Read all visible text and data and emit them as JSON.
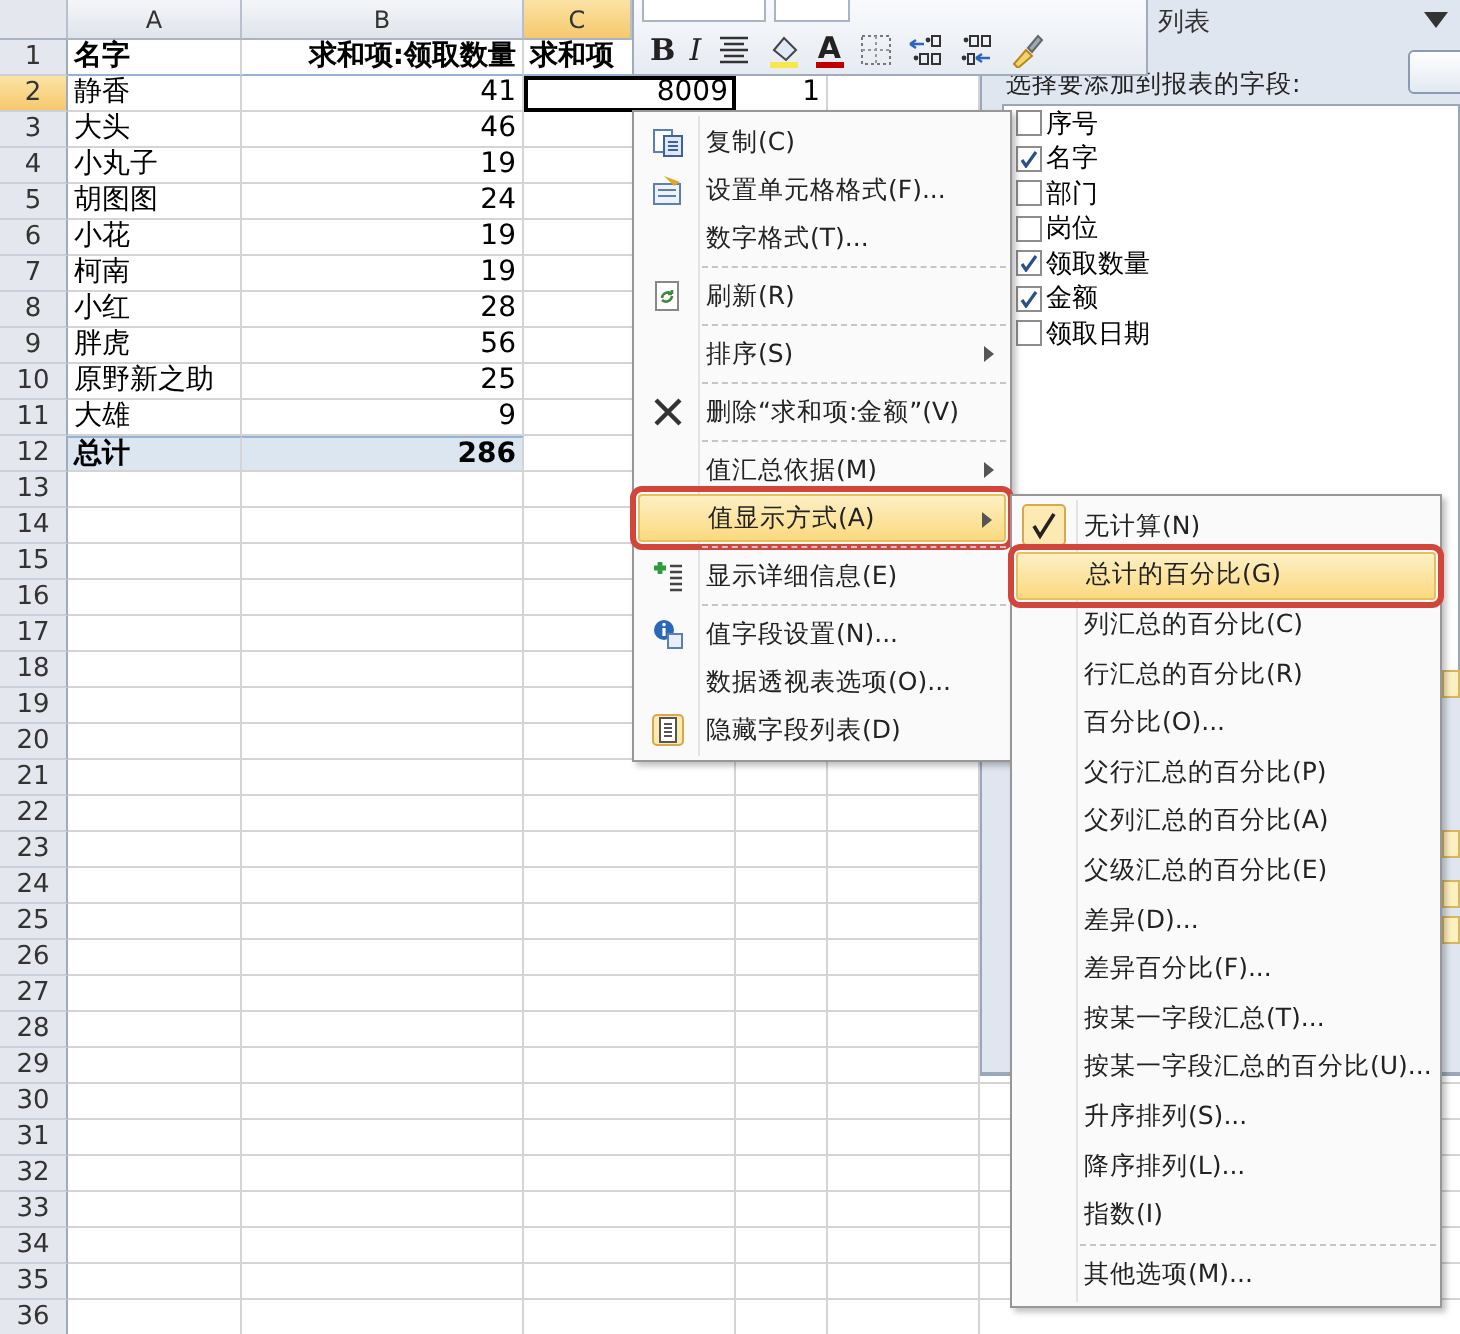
{
  "sheet": {
    "columns": [
      {
        "label": "A",
        "selected": false
      },
      {
        "label": "B",
        "selected": false
      },
      {
        "label": "C",
        "selected": true
      }
    ],
    "row_numbers": [
      {
        "label": "1",
        "selected": false
      },
      {
        "label": "2",
        "selected": true
      },
      {
        "label": "3",
        "selected": false
      },
      {
        "label": "4",
        "selected": false
      },
      {
        "label": "5",
        "selected": false
      },
      {
        "label": "6",
        "selected": false
      },
      {
        "label": "7",
        "selected": false
      },
      {
        "label": "8",
        "selected": false
      },
      {
        "label": "9",
        "selected": false
      },
      {
        "label": "10",
        "selected": false
      },
      {
        "label": "11",
        "selected": false
      },
      {
        "label": "12",
        "selected": false
      },
      {
        "label": "13",
        "selected": false
      },
      {
        "label": "14",
        "selected": false
      },
      {
        "label": "15",
        "selected": false
      },
      {
        "label": "16",
        "selected": false
      },
      {
        "label": "17",
        "selected": false
      },
      {
        "label": "18",
        "selected": false
      },
      {
        "label": "19",
        "selected": false
      },
      {
        "label": "20",
        "selected": false
      },
      {
        "label": "21",
        "selected": false
      },
      {
        "label": "22",
        "selected": false
      },
      {
        "label": "23",
        "selected": false
      },
      {
        "label": "24",
        "selected": false
      },
      {
        "label": "25",
        "selected": false
      },
      {
        "label": "26",
        "selected": false
      },
      {
        "label": "27",
        "selected": false
      },
      {
        "label": "28",
        "selected": false
      },
      {
        "label": "29",
        "selected": false
      },
      {
        "label": "30",
        "selected": false
      },
      {
        "label": "31",
        "selected": false
      },
      {
        "label": "32",
        "selected": false
      },
      {
        "label": "33",
        "selected": false
      },
      {
        "label": "34",
        "selected": false
      },
      {
        "label": "35",
        "selected": false
      },
      {
        "label": "36",
        "selected": false
      }
    ],
    "header_row": {
      "column_1": "名字",
      "column_2": "求和项:领取数量",
      "column_3": "求和项"
    },
    "rows": [
      {
        "name": "静香",
        "quantity": "41",
        "column_3": {
          "value": "8009",
          "selected": true
        },
        "column_4": "1"
      },
      {
        "name": "大头",
        "quantity": "46"
      },
      {
        "name": "小丸子",
        "quantity": "19"
      },
      {
        "name": "胡图图",
        "quantity": "24"
      },
      {
        "name": "小花",
        "quantity": "19"
      },
      {
        "name": "柯南",
        "quantity": "19"
      },
      {
        "name": "小红",
        "quantity": "28"
      },
      {
        "name": "胖虎",
        "quantity": "56"
      },
      {
        "name": "原野新之助",
        "quantity": "25"
      },
      {
        "name": "大雄",
        "quantity": "9"
      }
    ],
    "total": {
      "label": "总计",
      "value": "286"
    }
  },
  "mini_toolbar": {
    "buttons": [
      {
        "kind": "bold",
        "label": "B"
      },
      {
        "kind": "italic",
        "label": "I"
      },
      {
        "kind": "align"
      },
      {
        "kind": "fill"
      },
      {
        "kind": "font_color",
        "label": "A"
      },
      {
        "kind": "borders"
      },
      {
        "kind": "increase_decimal"
      },
      {
        "kind": "decrease_decimal"
      },
      {
        "kind": "format_painter"
      }
    ]
  },
  "field_list": {
    "title": "列表",
    "prompt": "选择要添加到报表的字段:",
    "fields": [
      {
        "label": "序号",
        "checked": false
      },
      {
        "label": "名字",
        "checked": true
      },
      {
        "label": "部门",
        "checked": false
      },
      {
        "label": "岗位",
        "checked": false
      },
      {
        "label": "领取数量",
        "checked": true
      },
      {
        "label": "金额",
        "checked": true
      },
      {
        "label": "领取日期",
        "checked": false
      }
    ]
  },
  "context_menu": {
    "items": [
      {
        "label": "复制(C)",
        "kind": "copy",
        "submenu": false,
        "selected": false,
        "separator_before": false
      },
      {
        "label": "设置单元格格式(F)...",
        "kind": "format",
        "submenu": false,
        "selected": false,
        "separator_before": false
      },
      {
        "label": "数字格式(T)...",
        "submenu": false,
        "selected": false,
        "separator_before": false
      },
      {
        "label": "刷新(R)",
        "kind": "refresh",
        "submenu": false,
        "selected": false,
        "separator_before": true
      },
      {
        "label": "排序(S)",
        "submenu": true,
        "selected": false,
        "separator_before": true
      },
      {
        "label": "删除“求和项:金额”(V)",
        "kind": "delete",
        "submenu": false,
        "selected": false,
        "separator_before": true
      },
      {
        "label": "值汇总依据(M)",
        "submenu": true,
        "selected": false,
        "separator_before": true
      },
      {
        "label": "值显示方式(A)",
        "submenu": true,
        "selected": true,
        "annotated": true,
        "separator_before": false
      },
      {
        "label": "显示详细信息(E)",
        "kind": "details",
        "submenu": false,
        "selected": false,
        "separator_before": true
      },
      {
        "label": "值字段设置(N)...",
        "kind": "settings",
        "submenu": false,
        "selected": false,
        "separator_before": true
      },
      {
        "label": "数据透视表选项(O)...",
        "submenu": false,
        "selected": false,
        "separator_before": false
      },
      {
        "label": "隐藏字段列表(D)",
        "kind": "hide_list",
        "submenu": false,
        "selected": false,
        "separator_before": false
      }
    ]
  },
  "submenu": {
    "items": [
      {
        "label": "无计算(N)",
        "checked": true,
        "selected": false,
        "separator_before": false
      },
      {
        "label": "总计的百分比(G)",
        "checked": false,
        "selected": true,
        "annotated": true,
        "separator_before": false
      },
      {
        "label": "列汇总的百分比(C)",
        "checked": false,
        "selected": false,
        "separator_before": false
      },
      {
        "label": "行汇总的百分比(R)",
        "checked": false,
        "selected": false,
        "separator_before": false
      },
      {
        "label": "百分比(O)...",
        "checked": false,
        "selected": false,
        "separator_before": false
      },
      {
        "label": "父行汇总的百分比(P)",
        "checked": false,
        "selected": false,
        "separator_before": false
      },
      {
        "label": "父列汇总的百分比(A)",
        "checked": false,
        "selected": false,
        "separator_before": false
      },
      {
        "label": "父级汇总的百分比(E)",
        "checked": false,
        "selected": false,
        "separator_before": false
      },
      {
        "label": "差异(D)...",
        "checked": false,
        "selected": false,
        "separator_before": false
      },
      {
        "label": "差异百分比(F)...",
        "checked": false,
        "selected": false,
        "separator_before": false
      },
      {
        "label": "按某一字段汇总(T)...",
        "checked": false,
        "selected": false,
        "separator_before": false
      },
      {
        "label": "按某一字段汇总的百分比(U)...",
        "checked": false,
        "selected": false,
        "separator_before": false
      },
      {
        "label": "升序排列(S)...",
        "checked": false,
        "selected": false,
        "separator_before": false
      },
      {
        "label": "降序排列(L)...",
        "checked": false,
        "selected": false,
        "separator_before": false
      },
      {
        "label": "指数(I)",
        "checked": false,
        "selected": false,
        "separator_before": false
      },
      {
        "label": "其他选项(M)...",
        "checked": false,
        "selected": false,
        "separator_before": true
      }
    ]
  }
}
